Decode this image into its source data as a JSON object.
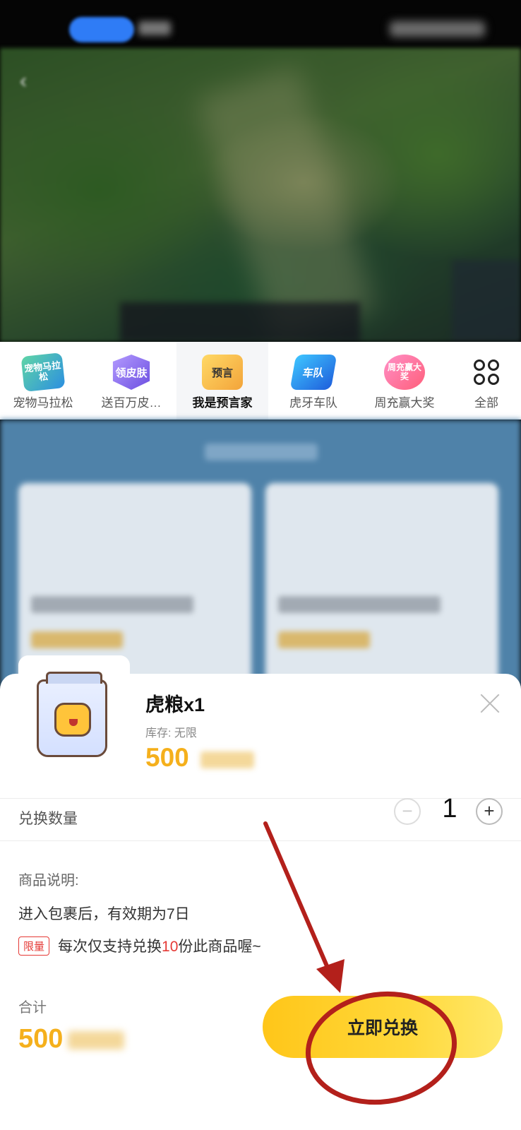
{
  "activity_strip": {
    "items": [
      {
        "label": "宠物马拉松",
        "icon_text": "宠物马拉松",
        "icon": "pet-marathon-icon"
      },
      {
        "label": "送百万皮…",
        "icon_text": "领皮肤",
        "icon": "skin-gift-icon"
      },
      {
        "label": "我是预言家",
        "icon_text": "预言",
        "icon": "prophet-icon",
        "active": true
      },
      {
        "label": "虎牙车队",
        "icon_text": "车队",
        "icon": "team-icon"
      },
      {
        "label": "周充赢大奖",
        "icon_text": "周充赢大奖",
        "icon": "weekly-recharge-icon"
      },
      {
        "label": "全部",
        "icon": "grid-icon"
      }
    ]
  },
  "product": {
    "name": "虎粮x1",
    "stock": "库存: 无限",
    "price": "500"
  },
  "quantity": {
    "label": "兑换数量",
    "minus": "−",
    "value": "1",
    "plus": "+"
  },
  "description": {
    "title": "商品说明:",
    "text": "进入包裹后，有效期为7日",
    "limit_badge": "限量",
    "limit_prefix": "每次仅支持兑换",
    "limit_number": "10",
    "limit_suffix": "份此商品喔~"
  },
  "total": {
    "label": "合计",
    "value": "500"
  },
  "exchange_button": {
    "label": "立即兑换"
  },
  "colors": {
    "price": "#f5b01c",
    "button": "#ffc619",
    "annotation": "#b3201b",
    "limit": "#e53935"
  }
}
